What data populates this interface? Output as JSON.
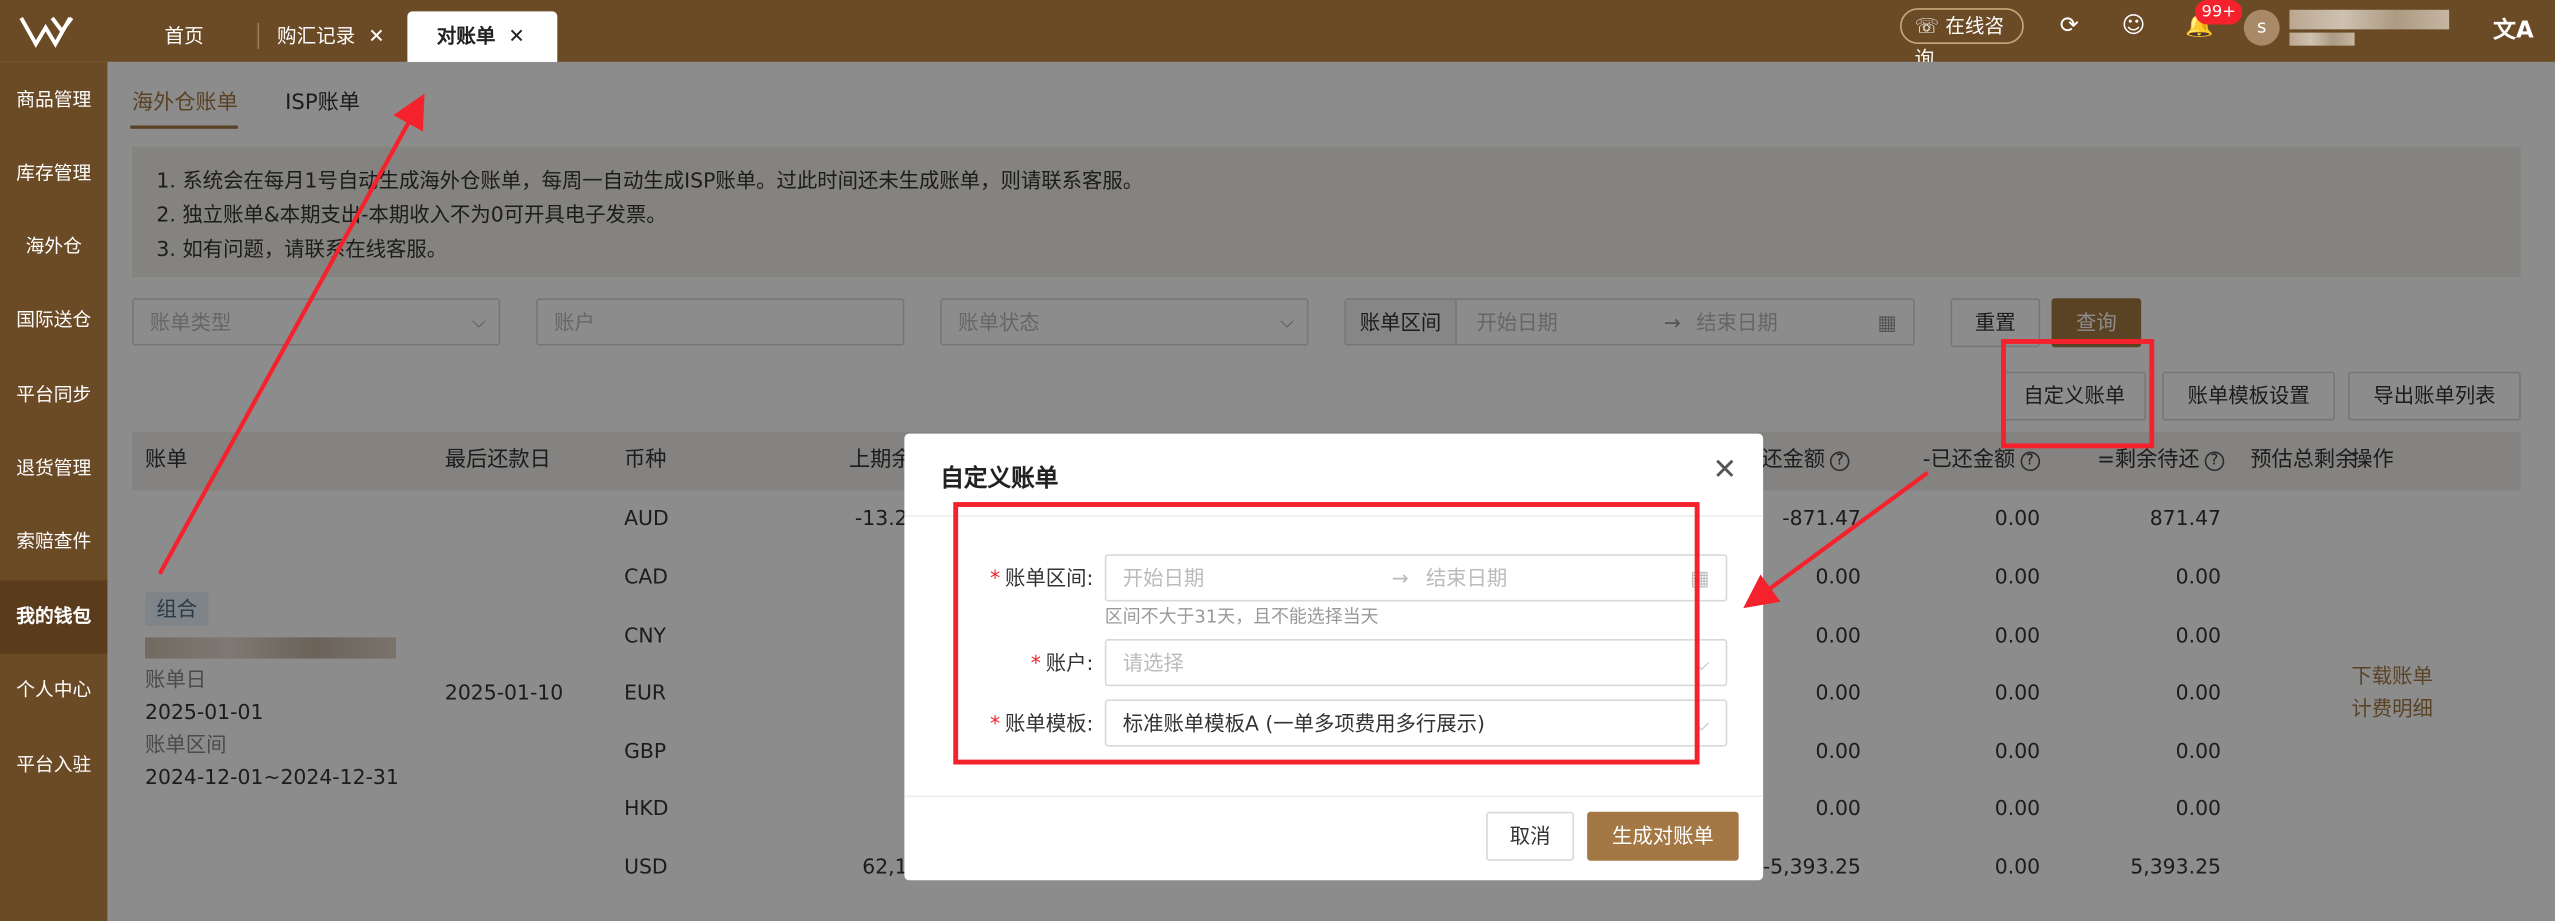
{
  "top_tabs": [
    {
      "label": "首页",
      "closable": false
    },
    {
      "label": "购汇记录",
      "closable": true
    },
    {
      "label": "对账单",
      "closable": true,
      "active": true
    }
  ],
  "top_tab_close": "✕",
  "topbar": {
    "consult": "在线咨询",
    "notifications_badge": "99+",
    "avatar_letter": "s"
  },
  "sidebar": [
    "商品管理",
    "库存管理",
    "海外仓",
    "国际送仓",
    "平台同步",
    "退货管理",
    "索赔查件",
    "我的钱包",
    "个人中心",
    "平台入驻"
  ],
  "sidebar_active": "我的钱包",
  "sub_tabs": [
    "海外仓账单",
    "ISP账单"
  ],
  "notice": [
    "1. 系统会在每月1号自动生成海外仓账单，每周一自动生成ISP账单。过此时间还未生成账单，则请联系客服。",
    "2. 独立账单&本期支出-本期收入不为0可开具电子发票。",
    "3. 如有问题，请联系在线客服。"
  ],
  "filters": {
    "bill_type": "账单类型",
    "account": "账户",
    "bill_status": "账单状态",
    "range_label": "账单区间",
    "start": "开始日期",
    "end": "结束日期",
    "range_sep": "→"
  },
  "buttons": {
    "reset": "重置",
    "query": "查询",
    "custom_bill": "自定义账单",
    "template_settings": "账单模板设置",
    "export": "导出账单列表"
  },
  "table": {
    "headers": {
      "bill": "账单",
      "last_repay": "最后还款日",
      "currency": "币种",
      "prev_balance": "上期余",
      "repay_amount": "还金额",
      "repaid": "-已还金额",
      "remaining": "=剩余待还",
      "estimated": "预估总剩余",
      "ops": "操作"
    },
    "bill_info": {
      "tag": "组合",
      "bill_date_label": "账单日",
      "bill_date": "2025-01-01",
      "range_label": "账单区间",
      "range": "2024-12-01~2024-12-31",
      "last_repay": "2025-01-10"
    },
    "rows": [
      {
        "currency": "AUD",
        "prev": "-13.2",
        "repay": "-871.47",
        "repaid": "0.00",
        "remaining": "871.47"
      },
      {
        "currency": "CAD",
        "prev": "",
        "repay": "0.00",
        "repaid": "0.00",
        "remaining": "0.00"
      },
      {
        "currency": "CNY",
        "prev": "",
        "repay": "0.00",
        "repaid": "0.00",
        "remaining": "0.00"
      },
      {
        "currency": "EUR",
        "prev": "",
        "repay": "0.00",
        "repaid": "0.00",
        "remaining": "0.00"
      },
      {
        "currency": "GBP",
        "prev": "",
        "repay": "0.00",
        "repaid": "0.00",
        "remaining": "0.00"
      },
      {
        "currency": "HKD",
        "prev": "",
        "repay": "0.00",
        "repaid": "0.00",
        "remaining": "0.00"
      },
      {
        "currency": "USD",
        "prev": "62,1",
        "repay": "-5,393.25",
        "repaid": "0.00",
        "remaining": "5,393.25"
      }
    ],
    "ops": [
      "下载账单",
      "计费明细"
    ]
  },
  "modal": {
    "title": "自定义账单",
    "close": "✕",
    "range_label": "账单区间:",
    "start": "开始日期",
    "end": "结束日期",
    "range_sep": "→",
    "range_hint": "区间不大于31天，且不能选择当天",
    "account_label": "账户:",
    "account_placeholder": "请选择",
    "template_label": "账单模板:",
    "template_value": "标准账单模板A (一单多项费用多行展示)",
    "cancel": "取消",
    "generate": "生成对账单"
  },
  "colors": {
    "brand": "#6b4a26",
    "accent": "#a47844",
    "annotation": "#f5222d"
  }
}
